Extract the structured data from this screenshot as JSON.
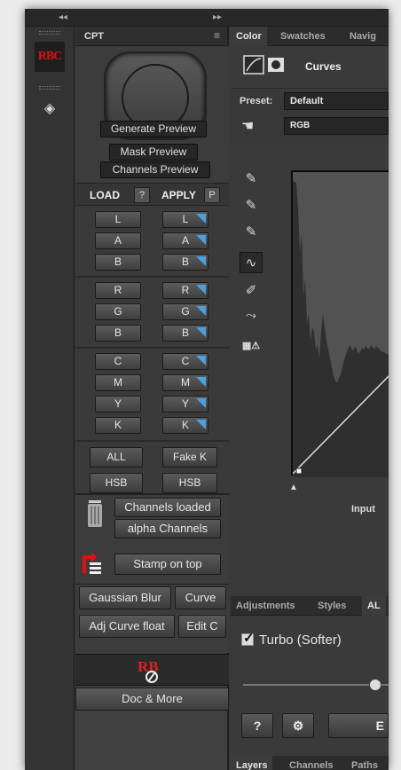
{
  "cpt_panel": {
    "title": "CPT",
    "preview": {
      "generate": "Generate Preview",
      "mask": "Mask Preview",
      "channels": "Channels Preview"
    },
    "load_label": "LOAD",
    "load_help": "?",
    "apply_label": "APPLY",
    "apply_p": "P",
    "lab": [
      "L",
      "A",
      "B"
    ],
    "rgb": [
      "R",
      "G",
      "B"
    ],
    "cmyk": [
      "C",
      "M",
      "Y",
      "K"
    ],
    "all": "ALL",
    "fake_k": "Fake K",
    "hsb_load": "HSB",
    "hsb_apply": "HSB",
    "channels_loaded": "Channels loaded",
    "alpha_channels": "alpha Channels",
    "stamp_on_top": "Stamp on top",
    "gaussian_blur": "Gaussian Blur",
    "curve": "Curve",
    "adj_curve_float": "Adj Curve float",
    "edit_c": "Edit C",
    "doc_more": "Doc & More",
    "logo_text": "RBC"
  },
  "right_panel": {
    "top_tabs": [
      "Color",
      "Swatches",
      "Navig"
    ],
    "curves_label": "Curves",
    "preset_label": "Preset:",
    "preset_value": "Default",
    "channel_value": "RGB",
    "input_label": "Input",
    "adj_tabs": [
      "Adjustments",
      "Styles",
      "AL"
    ],
    "turbo_label": "Turbo (Softer)",
    "help_button": "?",
    "partial_button": "E",
    "bottom_tabs": [
      "Layers",
      "Channels",
      "Paths"
    ]
  },
  "colors": {
    "accent_blue": "#4aa0e0",
    "logo_red": "#e01010",
    "panel_bg": "#404040"
  }
}
